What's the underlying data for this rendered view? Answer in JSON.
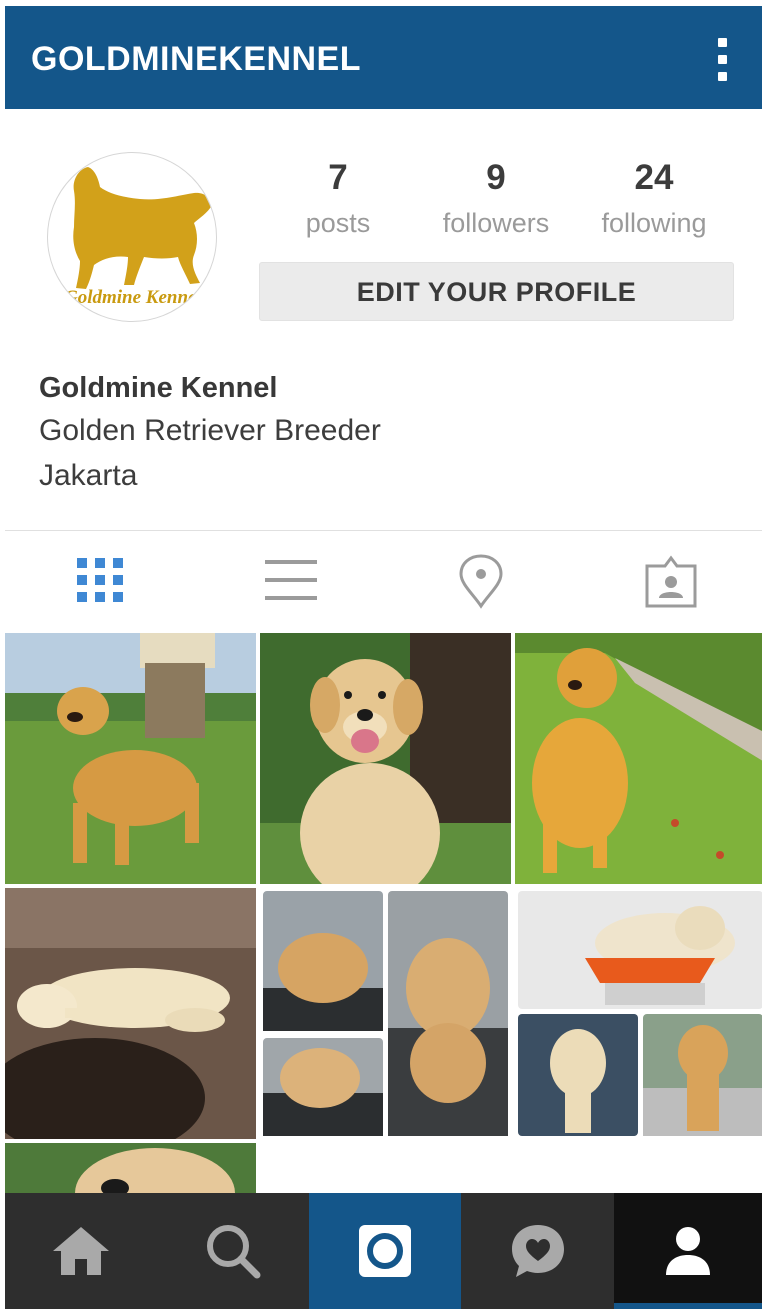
{
  "app": {
    "username": "GOLDMINEKENNEL",
    "menu_icon": "more-vertical-icon"
  },
  "profile": {
    "avatar_text": "Goldmine Kennel",
    "stats": {
      "posts": {
        "count": "7",
        "label": "posts"
      },
      "followers": {
        "count": "9",
        "label": "followers"
      },
      "following": {
        "count": "24",
        "label": "following"
      }
    },
    "edit_button": "EDIT YOUR PROFILE",
    "name": "Goldmine Kennel",
    "bio": [
      "Golden Retriever Breeder",
      "Jakarta"
    ]
  },
  "view_tabs": [
    {
      "icon": "grid-icon",
      "active": true
    },
    {
      "icon": "list-icon",
      "active": false
    },
    {
      "icon": "location-pin-icon",
      "active": false
    },
    {
      "icon": "tagged-person-icon",
      "active": false
    }
  ],
  "photos": [
    {
      "subject": "golden-retriever-standing-on-grass"
    },
    {
      "subject": "golden-retriever-smiling"
    },
    {
      "subject": "golden-retriever-sitting-on-lawn"
    },
    {
      "subject": "newborn-puppy-sleeping"
    },
    {
      "subject": "puppy-collage"
    },
    {
      "subject": "puppy-collage-on-scale"
    },
    {
      "subject": "golden-retriever-close-up"
    }
  ],
  "bottom_nav": [
    {
      "icon": "home-icon",
      "active": false
    },
    {
      "icon": "search-icon",
      "active": false
    },
    {
      "icon": "camera-icon",
      "active": false
    },
    {
      "icon": "activity-heart-icon",
      "active": false
    },
    {
      "icon": "profile-icon",
      "active": true
    }
  ],
  "colors": {
    "brand_blue": "#14568a",
    "tab_active": "#3f88d4",
    "tab_inactive": "#9b9b9b",
    "nav_dark": "#2e2e2e",
    "logo_gold": "#d2a11a"
  }
}
